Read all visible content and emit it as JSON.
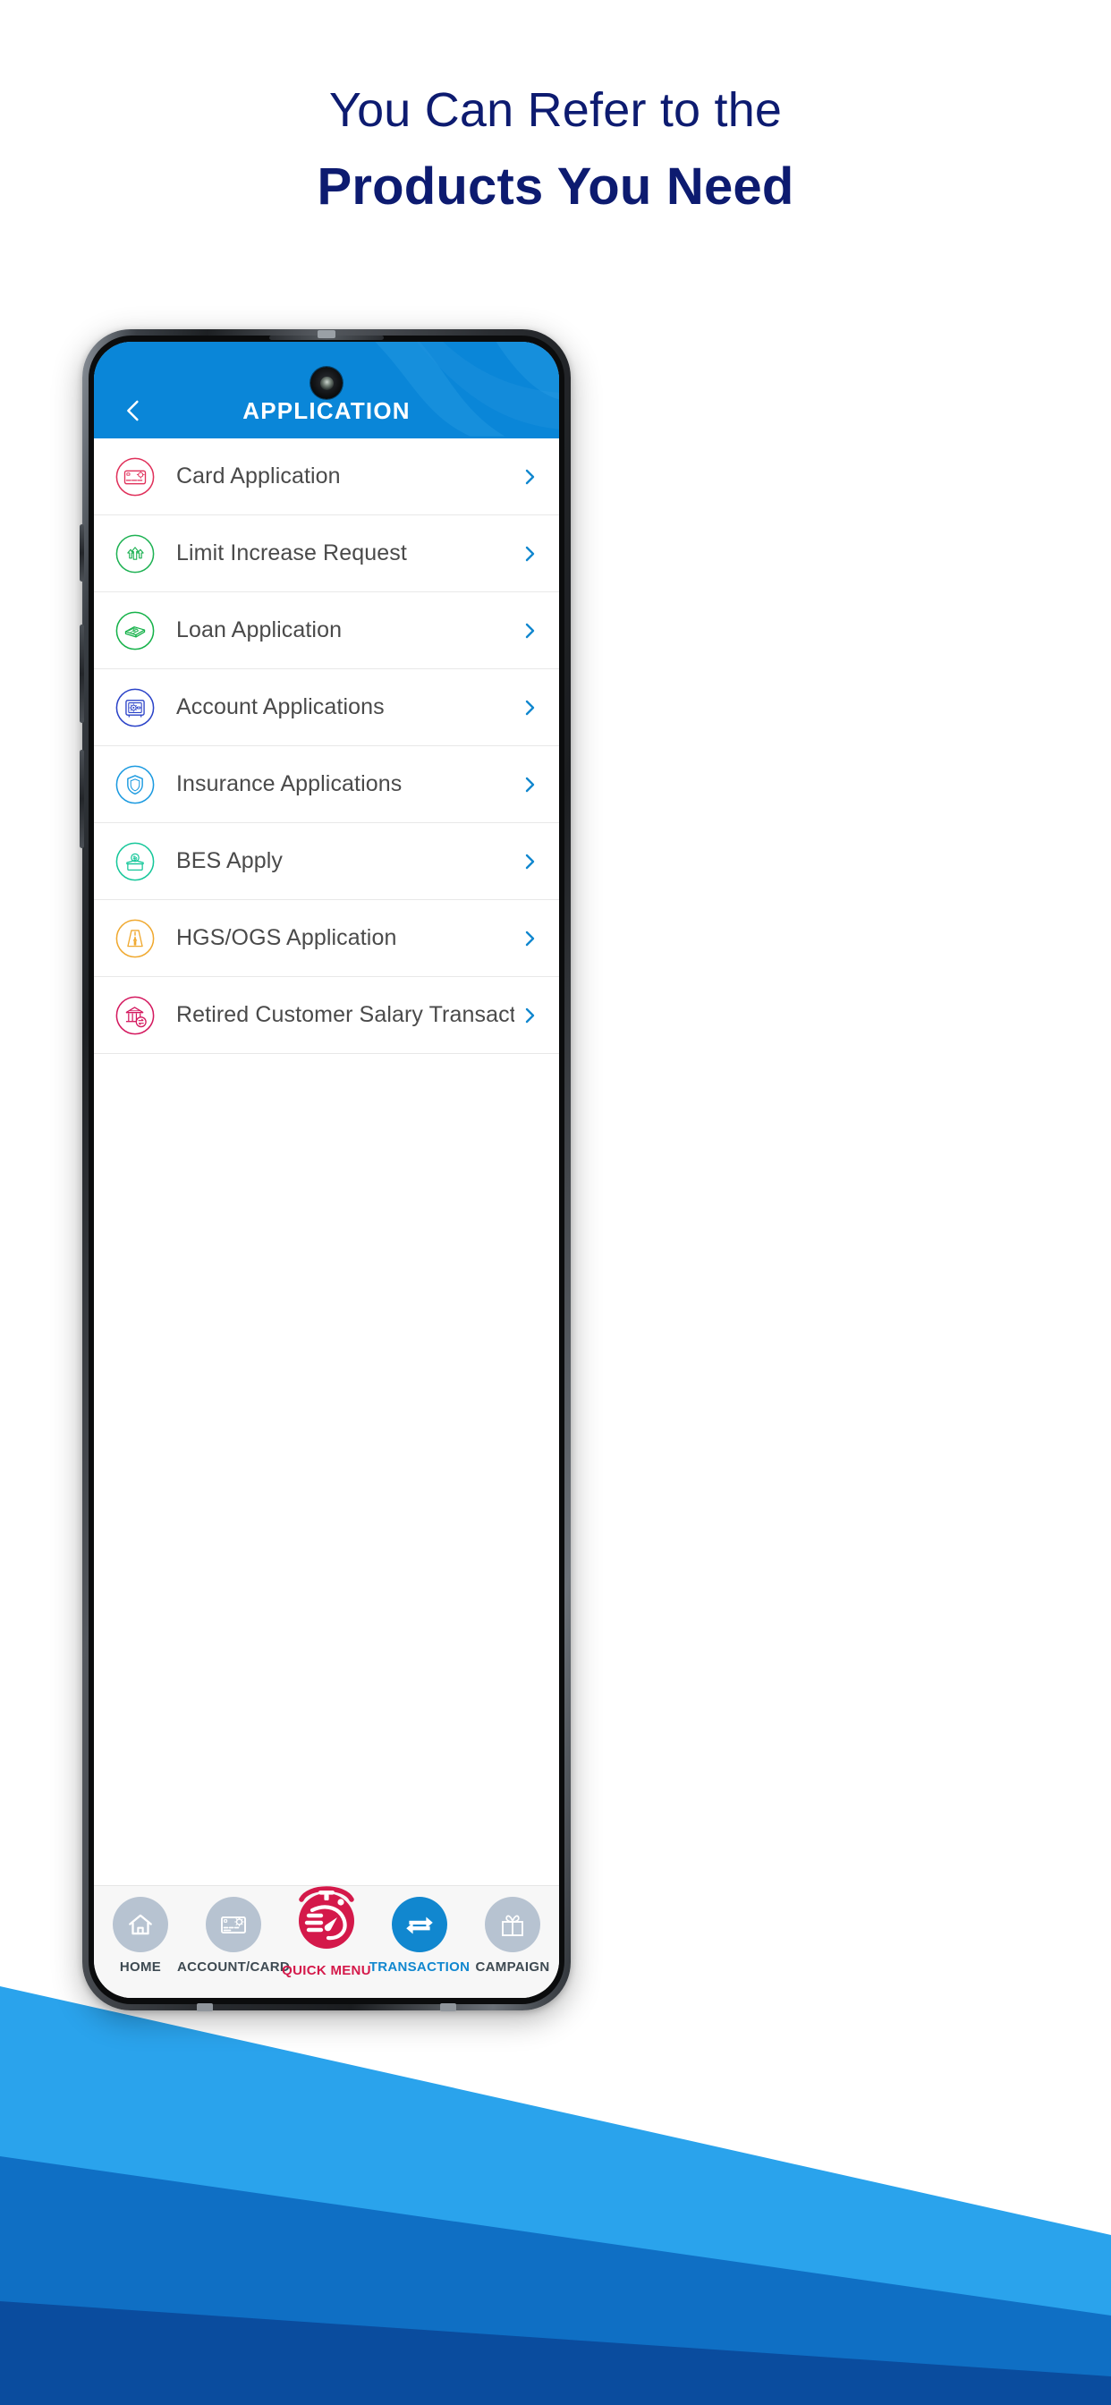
{
  "headline": {
    "line1": "You Can Refer to the",
    "line2": "Products You Need",
    "color": "#0d1b70"
  },
  "phone": {
    "header": {
      "title": "APPLICATION",
      "back_icon": "chevron-left-icon",
      "background_color": "#0a86d8",
      "title_color": "#ffffff"
    },
    "camera": {
      "icon": "front-camera-punch-hole"
    },
    "list": {
      "items": [
        {
          "label": "Card Application",
          "icon": "credit-card-icon",
          "color": "#e0315b",
          "chevron": "chevron-right-icon"
        },
        {
          "label": "Limit Increase Request",
          "icon": "up-arrows-icon",
          "color": "#1fb254",
          "chevron": "chevron-right-icon"
        },
        {
          "label": "Loan Application",
          "icon": "cash-stack-icon",
          "color": "#16b24a",
          "chevron": "chevron-right-icon"
        },
        {
          "label": "Account Applications",
          "icon": "safe-vault-icon",
          "color": "#2b43c8",
          "chevron": "chevron-right-icon"
        },
        {
          "label": "Insurance Applications",
          "icon": "shield-icon",
          "color": "#1b9ae0",
          "chevron": "chevron-right-icon"
        },
        {
          "label": "BES Apply",
          "icon": "coin-deposit-box-icon",
          "color": "#16c79a",
          "chevron": "chevron-right-icon"
        },
        {
          "label": "HGS/OGS Application",
          "icon": "road-sign-icon",
          "color": "#f0a930",
          "chevron": "chevron-right-icon"
        },
        {
          "label": "Retired Customer Salary Transactions",
          "icon": "bank-transfer-icon",
          "color": "#d4195f",
          "chevron": "chevron-right-icon"
        }
      ]
    },
    "bottom_nav": {
      "items": [
        {
          "label": "HOME",
          "icon": "home-icon",
          "active": false,
          "circle_color": "#b7c3d1",
          "label_color": "#3e4a52"
        },
        {
          "label": "ACCOUNT/CARD",
          "icon": "card-icon",
          "active": false,
          "circle_color": "#b7c3d1",
          "label_color": "#3e4a52"
        },
        {
          "label": "QUICK MENU",
          "icon": "stopwatch-icon",
          "active": true,
          "circle_color": "#d4194a",
          "label_color": "#d4194a"
        },
        {
          "label": "TRANSACTION",
          "icon": "transfer-arrows-icon",
          "active": false,
          "circle_color": "#1187cf",
          "label_color": "#1187cf"
        },
        {
          "label": "CAMPAIGN",
          "icon": "gift-icon",
          "active": false,
          "circle_color": "#b7c3d1",
          "label_color": "#3e4a52"
        }
      ]
    }
  },
  "background": {
    "wave_light": "#2aa3ec",
    "wave_mid": "#0f6fc4",
    "wave_dark": "#0a4c9e"
  }
}
